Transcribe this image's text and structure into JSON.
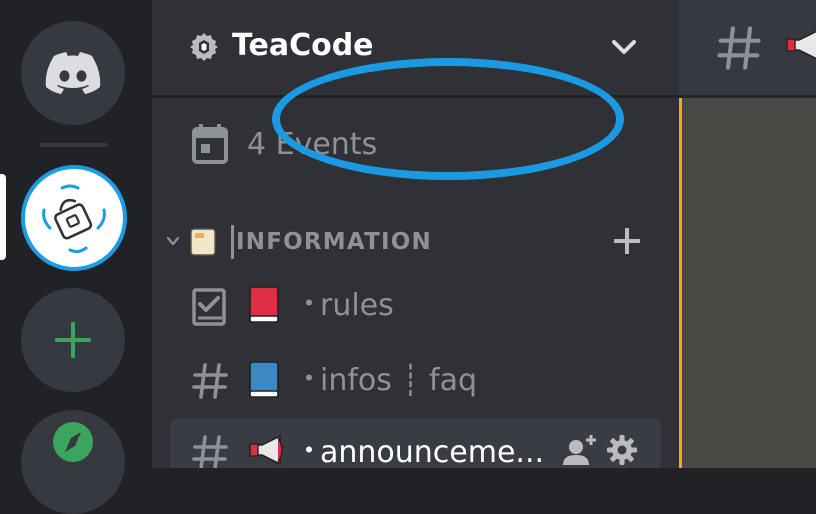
{
  "colors": {
    "rail_bg": "#202225",
    "sidebar_bg": "#2f3136",
    "muted_text": "#8e9297",
    "selected_channel_bg": "#393c43",
    "green_add": "#3ba55d",
    "highlight_oval": "#1a9ae3",
    "unread_border": "#faa61a"
  },
  "rail": {
    "servers": [
      {
        "icon": "discord-logo-icon"
      },
      {
        "icon": "teacode-server-icon"
      },
      {
        "icon": "plus-icon"
      },
      {
        "icon": "compass-icon"
      }
    ]
  },
  "guild": {
    "name": "TeaCode",
    "badge_icon": "server-badge-icon",
    "menu_icon": "chevron-down-icon"
  },
  "events": {
    "icon": "calendar-icon",
    "label": "4 Events"
  },
  "category": {
    "name": "INFORMATION",
    "emoji": "notebook-emoji",
    "collapse_icon": "chevron-down-icon",
    "add_icon": "plus-icon"
  },
  "channels": [
    {
      "icon": "rules-channel-icon",
      "emoji": "red-book-emoji",
      "separator": "・",
      "name": "rules",
      "selected": false
    },
    {
      "icon": "hash-icon",
      "emoji": "blue-book-emoji",
      "separator": "・",
      "name": "infos ┊ faq",
      "selected": false
    },
    {
      "icon": "hash-icon",
      "emoji": "megaphone-emoji",
      "separator": "・",
      "name": "announceme...",
      "selected": true
    }
  ],
  "channel_actions": {
    "invite_icon": "add-member-icon",
    "settings_icon": "gear-icon"
  },
  "main_header": {
    "icon": "hash-icon",
    "emoji": "megaphone-emoji"
  }
}
